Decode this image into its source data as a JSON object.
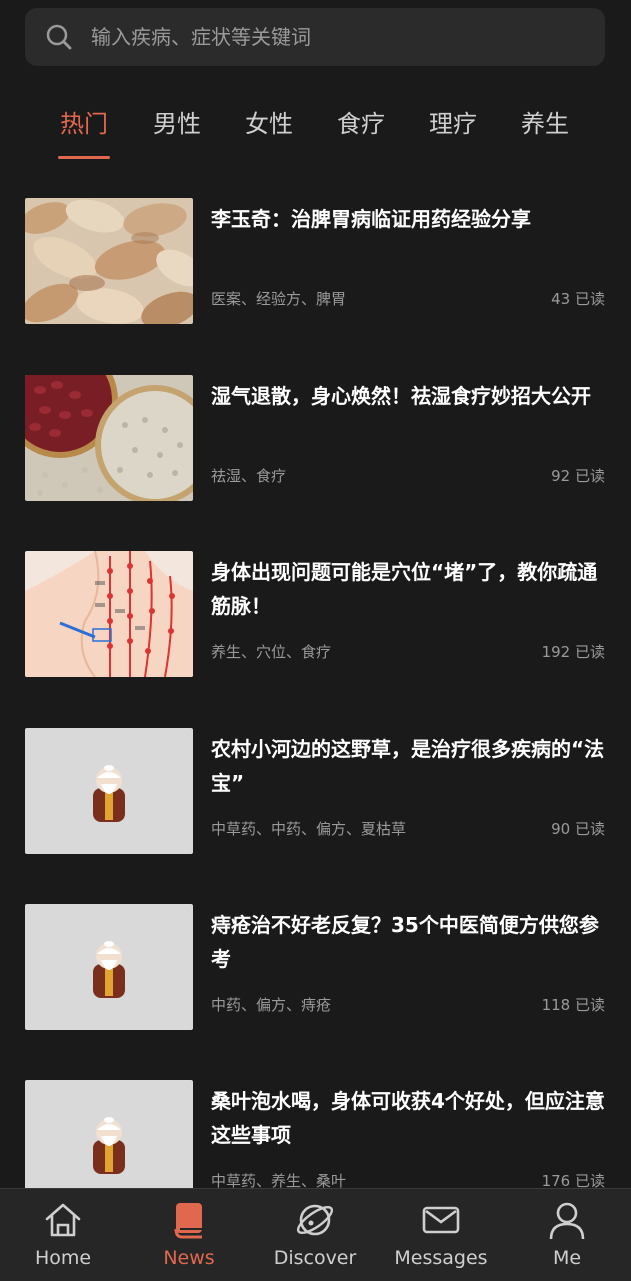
{
  "search": {
    "placeholder": "输入疾病、症状等关键词"
  },
  "tabs": [
    {
      "label": "热门",
      "active": true
    },
    {
      "label": "男性"
    },
    {
      "label": "女性"
    },
    {
      "label": "食疗"
    },
    {
      "label": "理疗"
    },
    {
      "label": "养生"
    }
  ],
  "articles": [
    {
      "title": "李玉奇：治脾胃病临证用药经验分享",
      "tags": "医案、经验方、脾胃",
      "reads": "43 已读",
      "thumb": "herb-slices"
    },
    {
      "title": "湿气退散，身心焕然！祛湿食疗妙招大公开",
      "tags": "祛湿、食疗",
      "reads": "92 已读",
      "thumb": "beans-barley"
    },
    {
      "title": "身体出现问题可能是穴位“堵”了，教你疏通筋脉！",
      "tags": "养生、穴位、食疗",
      "reads": "192 已读",
      "thumb": "acupoint-chart"
    },
    {
      "title": "农村小河边的这野草，是治疗很多疾病的“法宝”",
      "tags": "中草药、中药、偏方、夏枯草",
      "reads": "90 已读",
      "thumb": "elder-placeholder"
    },
    {
      "title": "痔疮治不好老反复？35个中医简便方供您参考",
      "tags": "中药、偏方、痔疮",
      "reads": "118 已读",
      "thumb": "elder-placeholder"
    },
    {
      "title": "桑叶泡水喝，身体可收获4个好处，但应注意这些事项",
      "tags": "中草药、养生、桑叶",
      "reads": "176 已读",
      "thumb": "elder-placeholder"
    }
  ],
  "nav": [
    {
      "label": "Home",
      "icon": "home-icon"
    },
    {
      "label": "News",
      "icon": "news-book-icon",
      "active": true
    },
    {
      "label": "Discover",
      "icon": "discover-planet-icon"
    },
    {
      "label": "Messages",
      "icon": "messages-envelope-icon"
    },
    {
      "label": "Me",
      "icon": "me-person-icon"
    }
  ],
  "colors": {
    "accent": "#e0684f",
    "background": "#1a1a1a",
    "card": "#2b2b2b",
    "muted": "#9a9a9a"
  }
}
